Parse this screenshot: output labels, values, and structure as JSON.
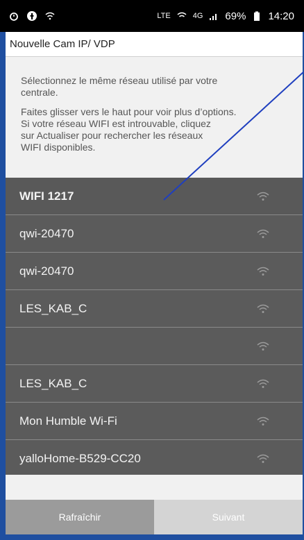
{
  "status_bar": {
    "left_icons": [
      "alarm-icon",
      "facebook-icon",
      "wifi-icon"
    ],
    "network_label": "LTE",
    "signal": "4G",
    "battery": "69%",
    "time": "14:20"
  },
  "header": {
    "title": "Nouvelle Cam IP/ VDP"
  },
  "content": {
    "para1": "Sélectionnez le même réseau utilisé par votre centrale.",
    "para2_line1": "Faites glisser vers le haut pour voir plus d’options.",
    "para2_line2": "Si votre réseau WIFI est introuvable, cliquez",
    "para2_line3": "sur Actualiser pour rechercher les réseaux",
    "para2_line4": "WIFI disponibles."
  },
  "wifi_list": [
    {
      "name": "WIFI 1217",
      "selected": true
    },
    {
      "name": "qwi-20470"
    },
    {
      "name": "qwi-20470"
    },
    {
      "name": "LES_KAB_C"
    },
    {
      "name": ""
    },
    {
      "name": "LES_KAB_C"
    },
    {
      "name": "Mon Humble Wi-Fi"
    },
    {
      "name": "yalloHome-B529-CC20"
    }
  ],
  "footer": {
    "refresh_label": "Rafraîchir",
    "next_label": "Suivant"
  },
  "colors": {
    "list_bg": "#5b5b5b",
    "annotation_line": "#1f3fbf",
    "frame": "#1f4fa0"
  }
}
